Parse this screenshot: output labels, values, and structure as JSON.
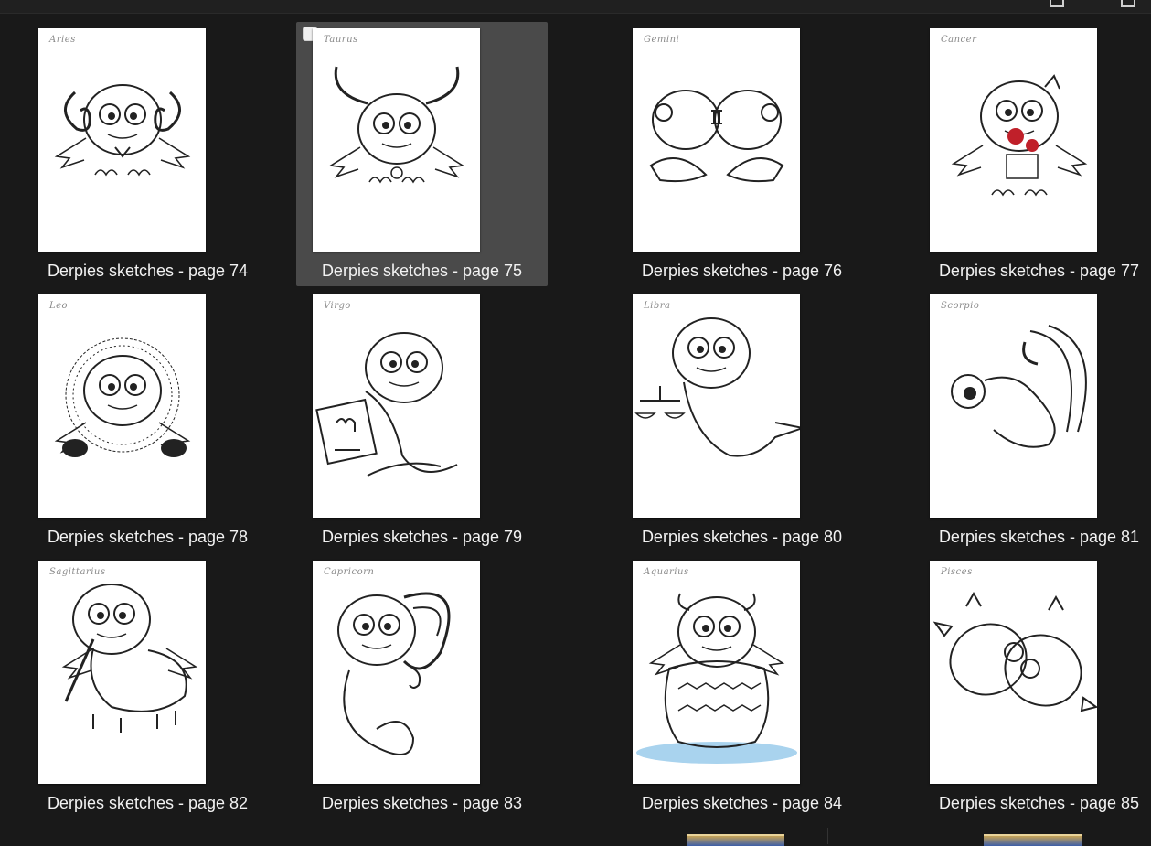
{
  "window": {
    "toolbar_icons": [
      "view-toggle-icon",
      "window-icon"
    ]
  },
  "items": [
    {
      "caption": "Derpies sketches - page 74",
      "sketch_label": "Aries",
      "selected": false,
      "creature": "ram"
    },
    {
      "caption": "Derpies sketches - page 75",
      "sketch_label": "Taurus",
      "selected": true,
      "creature": "bull"
    },
    {
      "caption": "Derpies sketches - page 76",
      "sketch_label": "Gemini",
      "selected": false,
      "creature": "twins"
    },
    {
      "caption": "Derpies sketches - page 77",
      "sketch_label": "Cancer",
      "selected": false,
      "creature": "crab"
    },
    {
      "caption": "Derpies sketches - page 78",
      "sketch_label": "Leo",
      "selected": false,
      "creature": "lion"
    },
    {
      "caption": "Derpies sketches - page 79",
      "sketch_label": "Virgo",
      "selected": false,
      "creature": "book"
    },
    {
      "caption": "Derpies sketches - page 80",
      "sketch_label": "Libra",
      "selected": false,
      "creature": "scales"
    },
    {
      "caption": "Derpies sketches - page 81",
      "sketch_label": "Scorpio",
      "selected": false,
      "creature": "scorpion"
    },
    {
      "caption": "Derpies sketches - page 82",
      "sketch_label": "Sagittarius",
      "selected": false,
      "creature": "archer"
    },
    {
      "caption": "Derpies sketches - page 83",
      "sketch_label": "Capricorn",
      "selected": false,
      "creature": "goat"
    },
    {
      "caption": "Derpies sketches - page 84",
      "sketch_label": "Aquarius",
      "selected": false,
      "creature": "water"
    },
    {
      "caption": "Derpies sketches - page 85",
      "sketch_label": "Pisces",
      "selected": false,
      "creature": "fish"
    }
  ],
  "colors": {
    "background": "#191919",
    "selection": "#4a4a4a",
    "caption_text": "#f2f2f2",
    "sketch_ink": "#222222",
    "cancer_accent": "#c0202a",
    "aquarius_water": "#a9d3ee"
  }
}
